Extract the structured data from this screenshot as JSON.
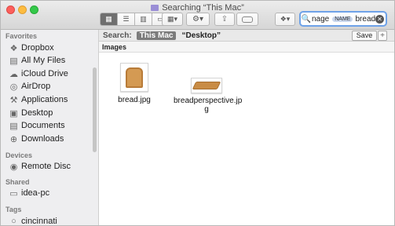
{
  "window": {
    "title": "Searching “This Mac”"
  },
  "toolbar": {
    "view_buttons": [
      "icon-view",
      "list-view",
      "column-view",
      "cover-flow-view"
    ],
    "search": {
      "kind_text": "nage",
      "token_label": "NAME",
      "token_value": "bread"
    }
  },
  "sidebar": {
    "sections": [
      {
        "heading": "Favorites",
        "items": [
          {
            "label": "Dropbox",
            "icon": "dropbox-icon"
          },
          {
            "label": "All My Files",
            "icon": "all-files-icon"
          },
          {
            "label": "iCloud Drive",
            "icon": "cloud-icon"
          },
          {
            "label": "AirDrop",
            "icon": "airdrop-icon"
          },
          {
            "label": "Applications",
            "icon": "applications-icon"
          },
          {
            "label": "Desktop",
            "icon": "desktop-icon"
          },
          {
            "label": "Documents",
            "icon": "documents-icon"
          },
          {
            "label": "Downloads",
            "icon": "downloads-icon"
          }
        ]
      },
      {
        "heading": "Devices",
        "items": [
          {
            "label": "Remote Disc",
            "icon": "remote-disc-icon"
          }
        ]
      },
      {
        "heading": "Shared",
        "items": [
          {
            "label": "idea-pc",
            "icon": "pc-icon"
          }
        ]
      },
      {
        "heading": "Tags",
        "items": [
          {
            "label": "cincinnati",
            "icon": "tag-icon"
          }
        ]
      }
    ]
  },
  "search_scope": {
    "label": "Search:",
    "active": "This Mac",
    "other": "“Desktop”",
    "save_label": "Save",
    "add_label": "+"
  },
  "results": {
    "group_label": "Images",
    "files": [
      {
        "name": "bread.jpg"
      },
      {
        "name_line1": "breadperspective.jp",
        "name_line2": "g"
      }
    ]
  }
}
